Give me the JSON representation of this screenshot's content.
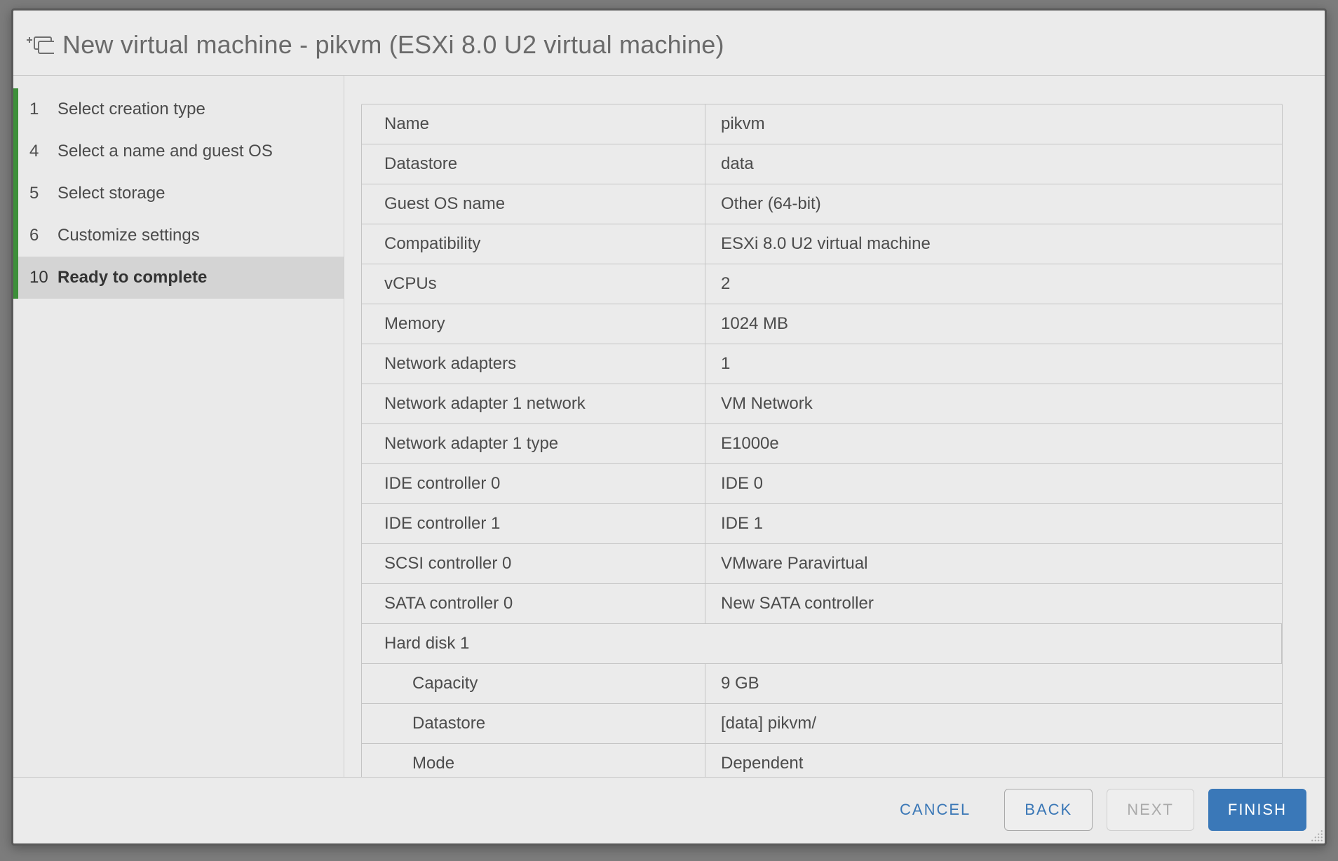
{
  "dialog": {
    "title": "New virtual machine - pikvm (ESXi 8.0 U2 virtual machine)"
  },
  "steps": [
    {
      "num": "1",
      "label": "Select creation type",
      "state": "completed"
    },
    {
      "num": "4",
      "label": "Select a name and guest OS",
      "state": "completed"
    },
    {
      "num": "5",
      "label": "Select storage",
      "state": "completed"
    },
    {
      "num": "6",
      "label": "Customize settings",
      "state": "completed"
    },
    {
      "num": "10",
      "label": "Ready to complete",
      "state": "active"
    }
  ],
  "summary": [
    {
      "key": "Name",
      "value": "pikvm"
    },
    {
      "key": "Datastore",
      "value": "data"
    },
    {
      "key": "Guest OS name",
      "value": "Other (64-bit)"
    },
    {
      "key": "Compatibility",
      "value": "ESXi 8.0 U2 virtual machine"
    },
    {
      "key": "vCPUs",
      "value": "2"
    },
    {
      "key": "Memory",
      "value": "1024 MB"
    },
    {
      "key": "Network adapters",
      "value": "1"
    },
    {
      "key": "Network adapter 1 network",
      "value": "VM Network"
    },
    {
      "key": "Network adapter 1 type",
      "value": "E1000e"
    },
    {
      "key": "IDE controller 0",
      "value": "IDE 0"
    },
    {
      "key": "IDE controller 1",
      "value": "IDE 1"
    },
    {
      "key": "SCSI controller 0",
      "value": "VMware Paravirtual"
    },
    {
      "key": "SATA controller 0",
      "value": "New SATA controller"
    },
    {
      "key": "Hard disk 1",
      "value": "",
      "full": true
    },
    {
      "key": "Capacity",
      "value": "9 GB",
      "indent": true
    },
    {
      "key": "Datastore",
      "value": "[data] pikvm/",
      "indent": true
    },
    {
      "key": "Mode",
      "value": "Dependent",
      "indent": true
    }
  ],
  "buttons": {
    "cancel": "CANCEL",
    "back": "BACK",
    "next": "NEXT",
    "finish": "FINISH"
  }
}
